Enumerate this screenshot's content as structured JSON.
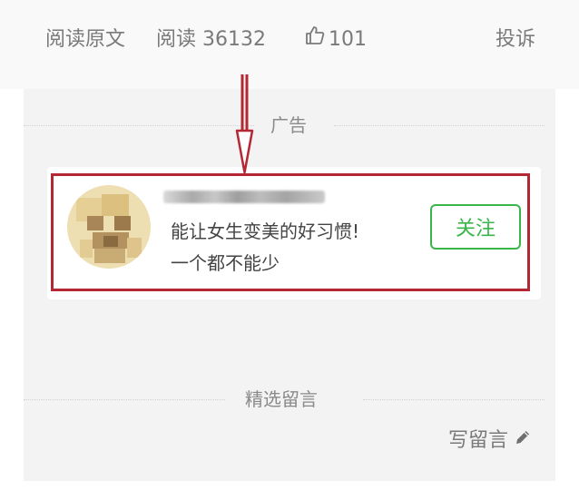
{
  "article_footer": {
    "read_original": "阅读原文",
    "views_label": "阅读",
    "views_count": "36132",
    "likes_count": "101",
    "complaint": "投诉"
  },
  "ad_section": {
    "label": "广告",
    "ad_card": {
      "description_line1": "能让女生变美的好习惯!",
      "description_line2": "一个都不能少",
      "follow_button": "关注"
    }
  },
  "comments": {
    "section_label": "精选留言",
    "write_comment": "写留言"
  },
  "colors": {
    "highlight": "#b52733",
    "follow_green": "#39b549",
    "secondary_text": "#7a7a7a"
  },
  "icons": {
    "like": "thumbs-up-icon",
    "write": "pencil-icon"
  }
}
